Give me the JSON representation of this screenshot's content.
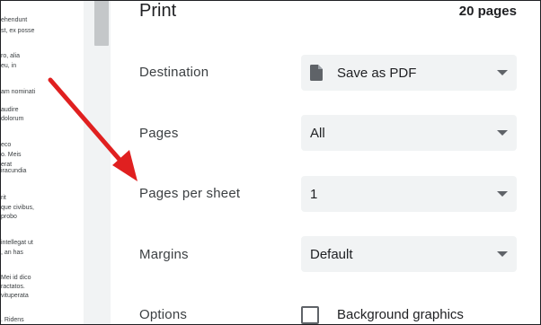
{
  "preview": {
    "lines": [
      "ehendunt",
      "st, ex posse",
      "ro, alia",
      "eu, in",
      "am nominati",
      "audire",
      "dolorum",
      "eco",
      "o. Meis",
      "erat",
      "iracundia",
      "rit",
      "que civibus,",
      "probo",
      "intellegat ut",
      ", an has",
      "Mei id dico",
      "ractatos.",
      "vituperata",
      ". Ridens"
    ]
  },
  "header": {
    "title": "Print",
    "page_count": "20 pages"
  },
  "settings": {
    "destination": {
      "label": "Destination",
      "value": "Save as PDF",
      "icon": "pdf-file-icon"
    },
    "pages": {
      "label": "Pages",
      "value": "All"
    },
    "pages_per_sheet": {
      "label": "Pages per sheet",
      "value": "1"
    },
    "margins": {
      "label": "Margins",
      "value": "Default"
    },
    "options": {
      "label": "Options",
      "background_graphics": "Background graphics",
      "checked": false
    }
  },
  "annotation": {
    "arrow_color": "#e02020"
  },
  "colors": {
    "select_bg": "#f1f3f4",
    "text": "#202124"
  }
}
